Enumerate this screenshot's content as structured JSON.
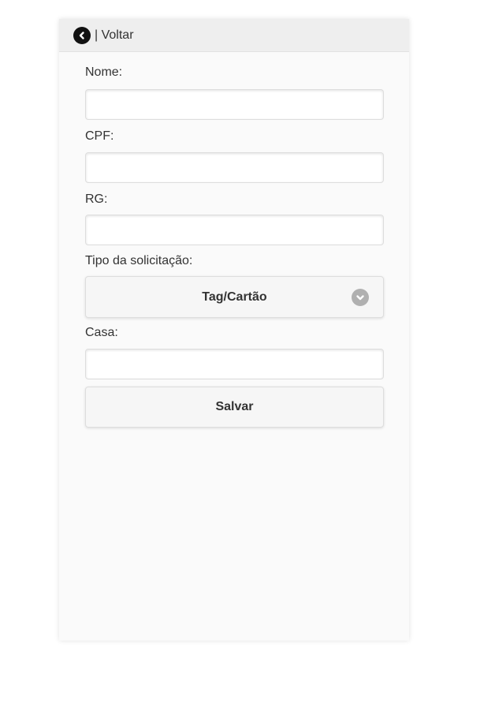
{
  "header": {
    "back_label": "| Voltar",
    "back_icon": "chevron-left-circle-icon"
  },
  "form": {
    "nome": {
      "label": "Nome:",
      "value": "",
      "placeholder": ""
    },
    "cpf": {
      "label": "CPF:",
      "value": "",
      "placeholder": ""
    },
    "rg": {
      "label": "RG:",
      "value": "",
      "placeholder": ""
    },
    "tipo": {
      "label": "Tipo da solicitação:",
      "selected": "Tag/Cartão",
      "icon": "chevron-down-circle-icon"
    },
    "casa": {
      "label": "Casa:",
      "value": "",
      "placeholder": ""
    },
    "save_label": "Salvar"
  },
  "colors": {
    "header_bg": "#eeeeee",
    "page_bg": "#fafafa",
    "button_bg": "#f6f6f6",
    "text": "#333333",
    "dropdown_icon": "#b0b0b0"
  }
}
